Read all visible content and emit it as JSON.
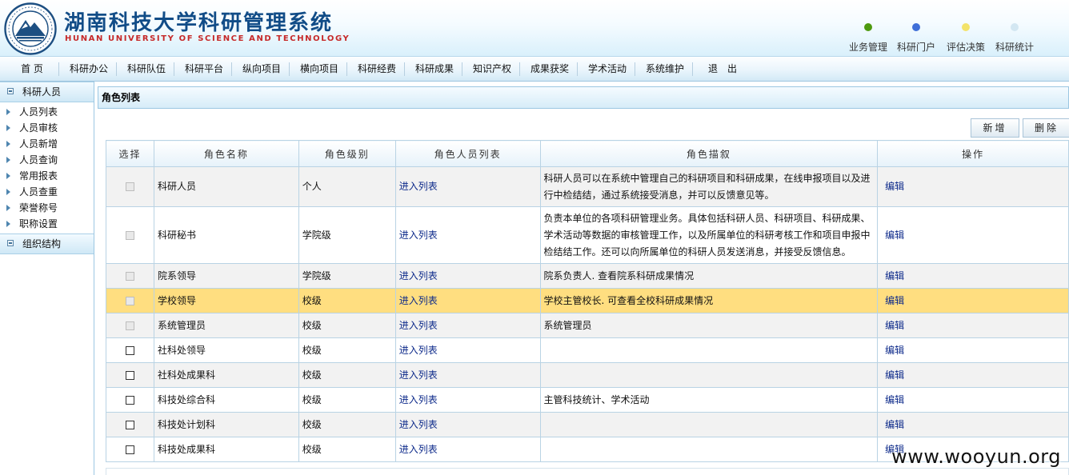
{
  "header": {
    "title": "湖南科技大学科研管理系统",
    "subtitle": "HUNAN UNIVERSITY OF SCIENCE AND TECHNOLOGY",
    "logo_icon": "university-seal-icon",
    "quick_links": [
      {
        "label": "业务管理",
        "color": "#4e9a0f"
      },
      {
        "label": "科研门户",
        "color": "#3f6fd8"
      },
      {
        "label": "评估决策",
        "color": "#f3e36a"
      },
      {
        "label": "科研统计",
        "color": "#d3e7f2"
      }
    ]
  },
  "nav": {
    "items": [
      "首 页",
      "科研办公",
      "科研队伍",
      "科研平台",
      "纵向项目",
      "横向项目",
      "科研经费",
      "科研成果",
      "知识产权",
      "成果获奖",
      "学术活动",
      "系统维护",
      "退　出"
    ]
  },
  "sidebar": {
    "sections": [
      {
        "label": "科研人员",
        "items": [
          "人员列表",
          "人员审核",
          "人员新增",
          "人员查询",
          "常用报表",
          "人员查重",
          "荣誉称号",
          "职称设置"
        ]
      },
      {
        "label": "组织结构",
        "items": []
      }
    ]
  },
  "main": {
    "panel_title": "角色列表",
    "buttons": {
      "add": "新增",
      "delete": "删除"
    },
    "columns": [
      "选择",
      "角色名称",
      "角色级别",
      "角色人员列表",
      "角色描叙",
      "操作"
    ],
    "link_label": "进入列表",
    "edit_label": "编辑",
    "rows": [
      {
        "name": "科研人员",
        "level": "个人",
        "desc": "科研人员可以在系统中管理自己的科研项目和科研成果，在线申报项目以及进行中检结结，通过系统接受消息，并可以反馈意见等。",
        "disabled": true,
        "style": "gray"
      },
      {
        "name": "科研秘书",
        "level": "学院级",
        "desc": "负责本单位的各项科研管理业务。具体包括科研人员、科研项目、科研成果、学术活动等数据的审核管理工作，以及所属单位的科研考核工作和项目申报中检结结工作。还可以向所属单位的科研人员发送消息，并接受反馈信息。",
        "disabled": true,
        "style": "white"
      },
      {
        "name": "院系领导",
        "level": "学院级",
        "desc": "院系负责人. 查看院系科研成果情况",
        "disabled": true,
        "style": "gray"
      },
      {
        "name": "学校领导",
        "level": "校级",
        "desc": "学校主管校长. 可查看全校科研成果情况",
        "disabled": true,
        "style": "hl"
      },
      {
        "name": "系统管理员",
        "level": "校级",
        "desc": "系统管理员",
        "disabled": true,
        "style": "gray"
      },
      {
        "name": "社科处领导",
        "level": "校级",
        "desc": "",
        "disabled": false,
        "style": "white"
      },
      {
        "name": "社科处成果科",
        "level": "校级",
        "desc": "",
        "disabled": false,
        "style": "gray"
      },
      {
        "name": "科技处综合科",
        "level": "校级",
        "desc": "主管科技统计、学术活动",
        "disabled": false,
        "style": "white"
      },
      {
        "name": "科技处计划科",
        "level": "校级",
        "desc": "",
        "disabled": false,
        "style": "gray"
      },
      {
        "name": "科技处成果科",
        "level": "校级",
        "desc": "",
        "disabled": false,
        "style": "white"
      }
    ]
  },
  "watermark": "www.wooyun.org"
}
